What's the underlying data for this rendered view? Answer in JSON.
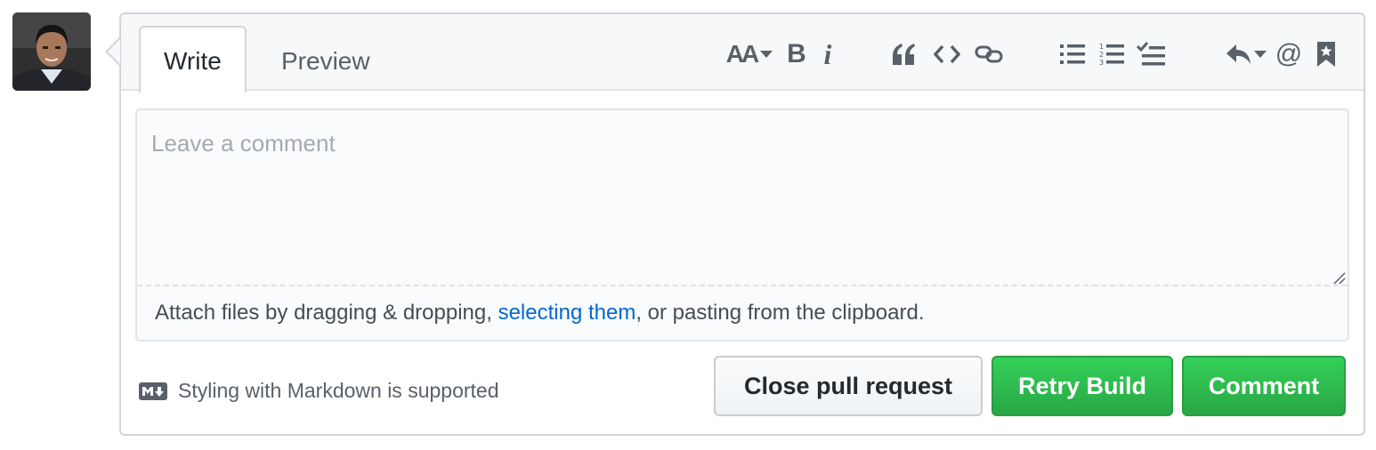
{
  "tabs": [
    {
      "label": "Write",
      "selected": true
    },
    {
      "label": "Preview",
      "selected": false
    }
  ],
  "toolbar": {
    "icons": [
      "text-size-icon",
      "bold-icon",
      "italic-icon",
      "quote-icon",
      "code-icon",
      "link-icon",
      "unordered-list-icon",
      "ordered-list-icon",
      "task-list-icon",
      "reply-icon",
      "mention-icon",
      "reference-icon"
    ],
    "header_label": "AA",
    "bold_label": "B",
    "italic_label": "i",
    "mention_label": "@"
  },
  "editor": {
    "placeholder": "Leave a comment",
    "attach_prefix": "Attach files by dragging & dropping, ",
    "attach_link": "selecting them",
    "attach_suffix": ", or pasting from the clipboard."
  },
  "footer": {
    "markdown_note": "Styling with Markdown is supported"
  },
  "buttons": {
    "close_label": "Close pull request",
    "retry_label": "Retry Build",
    "comment_label": "Comment"
  },
  "colors": {
    "accent_green": "#28a745",
    "link_blue": "#0366d6",
    "border": "#d1d5da"
  }
}
